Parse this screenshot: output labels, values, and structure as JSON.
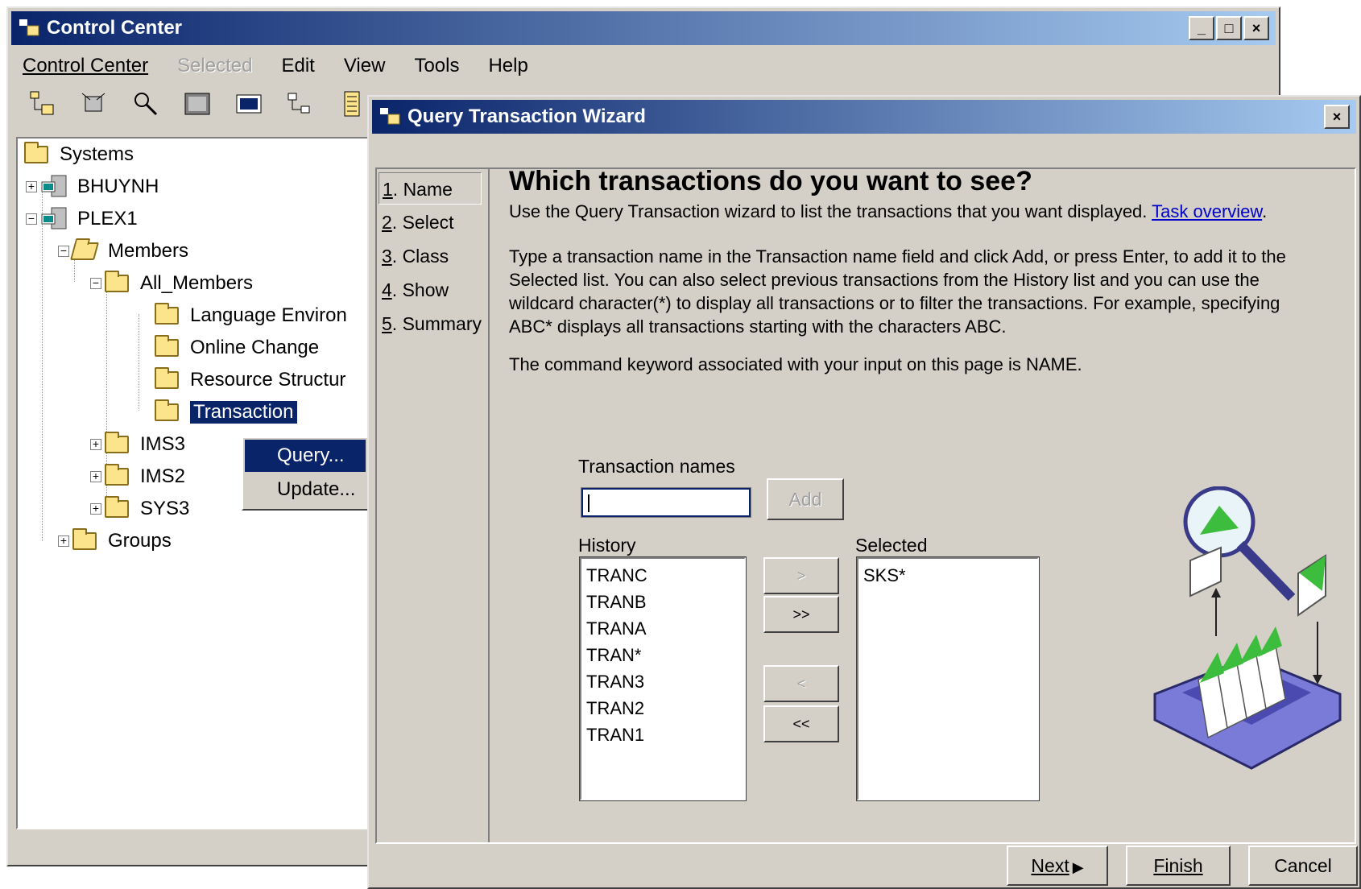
{
  "main_window": {
    "title": "Control Center",
    "menu": [
      "Control Center",
      "Selected",
      "Edit",
      "View",
      "Tools",
      "Help"
    ],
    "window_controls": [
      "_",
      "□",
      "×"
    ],
    "toolbar_icons": [
      "systems-icon",
      "connect-icon",
      "search-icon",
      "database-icon",
      "command-icon",
      "topology-icon",
      "list-icon"
    ],
    "tree": {
      "systems": "Systems",
      "bhuynh": "BHUYNH",
      "plex1": "PLEX1",
      "members": "Members",
      "all_members": "All_Members",
      "language_env": "Language Environ",
      "online_change": "Online Change",
      "resource_structure": "Resource Structur",
      "transaction": "Transaction",
      "ims3": "IMS3",
      "ims2": "IMS2",
      "sys3": "SYS3",
      "groups": "Groups"
    },
    "context_menu": {
      "query": "Query...",
      "update": "Update..."
    }
  },
  "wizard": {
    "title": "Query Transaction Wizard",
    "close": "×",
    "steps": [
      {
        "num": "1",
        "label": ". Name"
      },
      {
        "num": "2",
        "label": ". Select"
      },
      {
        "num": "3",
        "label": ". Class"
      },
      {
        "num": "4",
        "label": ". Show"
      },
      {
        "num": "5",
        "label": ". Summary"
      }
    ],
    "heading": "Which transactions do you want to see?",
    "intro": "Use the Query Transaction wizard to list the transactions that you want displayed.",
    "task_link": "Task overview",
    "intro_end": ".",
    "para1_l1": "Type a transaction name in the Transaction name field and click Add, or press Enter, to add it to the",
    "para1_l2": "Selected list. You can also select previous transactions from the History list and you can use the",
    "para1_l3": "wildcard character(*) to display all transactions or to filter the transactions.  For example, specifying",
    "para1_l4": "ABC* displays all transactions starting with the characters ABC.",
    "para2": "The command keyword associated with your input on this page is NAME.",
    "transaction_names_label": "Transaction names",
    "transaction_input_value": "",
    "add_button": "Add",
    "history_label": "History",
    "history_items": [
      "TRANC",
      "TRANB",
      "TRANA",
      "TRAN*",
      "TRAN3",
      "TRAN2",
      "TRAN1"
    ],
    "selected_label": "Selected",
    "selected_items": [
      "SKS*"
    ],
    "move_buttons": {
      "add_one": ">",
      "add_all": ">>",
      "remove_one": "<",
      "remove_all": "<<"
    },
    "footer": {
      "next": "Next",
      "next_arrow": "▶",
      "finish": "Finish",
      "cancel": "Cancel"
    }
  }
}
